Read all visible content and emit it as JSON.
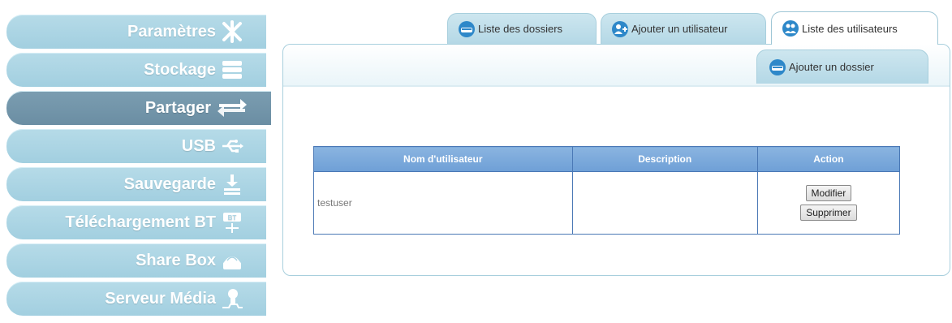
{
  "sidebar": {
    "items": [
      {
        "label": "Paramètres",
        "icon": "settings-tools-icon"
      },
      {
        "label": "Stockage",
        "icon": "storage-icon"
      },
      {
        "label": "Partager",
        "icon": "share-arrows-icon",
        "active": true
      },
      {
        "label": "USB",
        "icon": "usb-icon"
      },
      {
        "label": "Sauvegarde",
        "icon": "backup-icon"
      },
      {
        "label": "Téléchargement BT",
        "icon": "bittorrent-icon"
      },
      {
        "label": "Share Box",
        "icon": "share-box-icon"
      },
      {
        "label": "Serveur Média",
        "icon": "media-server-icon"
      }
    ]
  },
  "tabs": [
    {
      "label": "Liste des dossiers",
      "icon": "folder-drive-icon"
    },
    {
      "label": "Ajouter un utilisateur",
      "icon": "add-user-icon"
    },
    {
      "label": "Liste des utilisateurs",
      "icon": "users-list-icon",
      "active": true
    }
  ],
  "subtab": {
    "label": "Ajouter un dossier",
    "icon": "add-folder-icon"
  },
  "table": {
    "headers": [
      "Nom d'utilisateur",
      "Description",
      "Action"
    ],
    "rows": [
      {
        "username": "testuser",
        "description": "",
        "actions": [
          "Modifier",
          "Supprimer"
        ]
      }
    ]
  },
  "colors": {
    "nav": "#a8d3e3",
    "nav_active": "#7196aa",
    "table_header": "#7aa8da",
    "table_border": "#4a78b5"
  }
}
